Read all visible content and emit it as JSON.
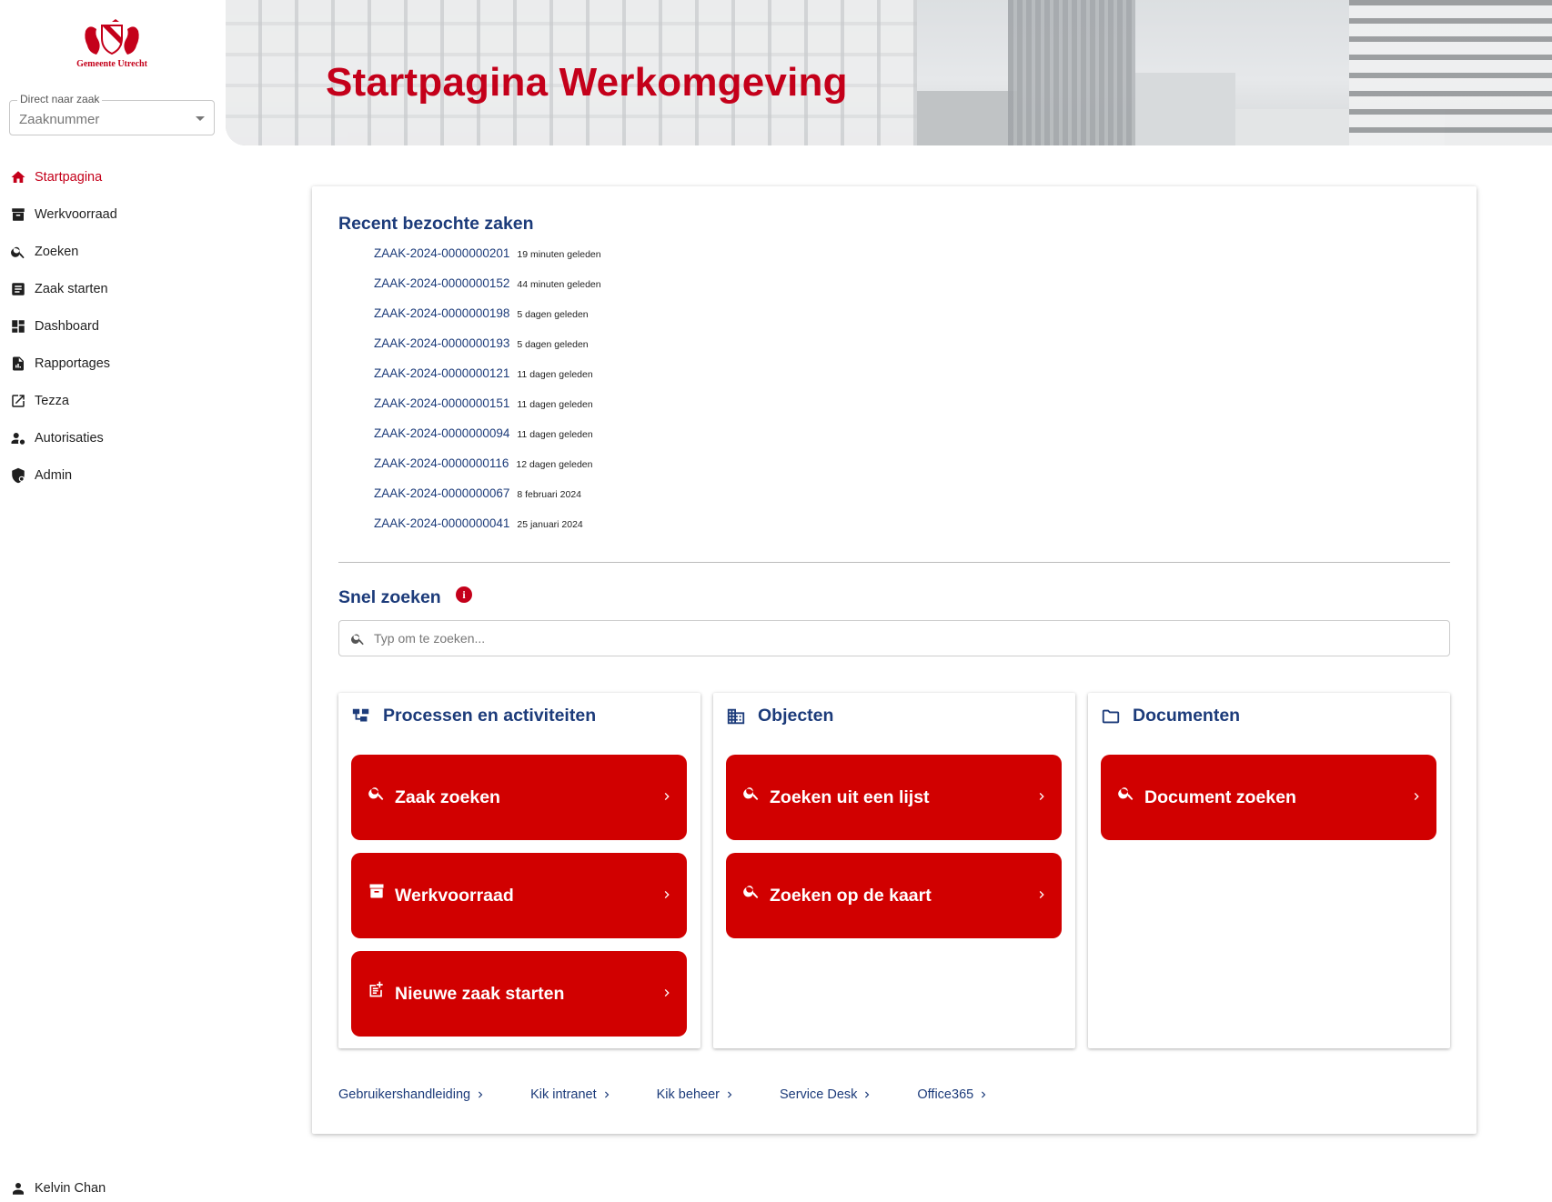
{
  "logo": {
    "text": "Gemeente Utrecht"
  },
  "direct": {
    "label": "Direct naar zaak",
    "placeholder": "Zaaknummer"
  },
  "nav": [
    {
      "label": "Startpagina",
      "icon": "home-icon",
      "active": true
    },
    {
      "label": "Werkvoorraad",
      "icon": "archive-icon"
    },
    {
      "label": "Zoeken",
      "icon": "search-icon"
    },
    {
      "label": "Zaak starten",
      "icon": "document-icon"
    },
    {
      "label": "Dashboard",
      "icon": "dashboard-icon"
    },
    {
      "label": "Rapportages",
      "icon": "report-icon"
    },
    {
      "label": "Tezza",
      "icon": "external-link-icon"
    },
    {
      "label": "Autorisaties",
      "icon": "user-gear-icon"
    },
    {
      "label": "Admin",
      "icon": "admin-shield-icon"
    }
  ],
  "user": {
    "name": "Kelvin Chan"
  },
  "banner": {
    "title": "Startpagina Werkomgeving"
  },
  "recent": {
    "title": "Recent bezochte zaken",
    "items": [
      {
        "id": "ZAAK-2024-0000000201",
        "time": "19 minuten geleden"
      },
      {
        "id": "ZAAK-2024-0000000152",
        "time": "44 minuten geleden"
      },
      {
        "id": "ZAAK-2024-0000000198",
        "time": "5 dagen geleden"
      },
      {
        "id": "ZAAK-2024-0000000193",
        "time": "5 dagen geleden"
      },
      {
        "id": "ZAAK-2024-0000000121",
        "time": "11 dagen geleden"
      },
      {
        "id": "ZAAK-2024-0000000151",
        "time": "11 dagen geleden"
      },
      {
        "id": "ZAAK-2024-0000000094",
        "time": "11 dagen geleden"
      },
      {
        "id": "ZAAK-2024-0000000116",
        "time": "12 dagen geleden"
      },
      {
        "id": "ZAAK-2024-0000000067",
        "time": "8 februari 2024"
      },
      {
        "id": "ZAAK-2024-0000000041",
        "time": "25 januari 2024"
      }
    ]
  },
  "snel": {
    "title": "Snel zoeken",
    "info": "i",
    "placeholder": "Typ om te zoeken..."
  },
  "panels": {
    "processen": {
      "title": "Processen en activiteiten",
      "buttons": [
        "Zaak zoeken",
        "Werkvoorraad",
        "Nieuwe zaak starten"
      ]
    },
    "objecten": {
      "title": "Objecten",
      "buttons": [
        "Zoeken uit een lijst",
        "Zoeken op de kaart"
      ]
    },
    "documenten": {
      "title": "Documenten",
      "buttons": [
        "Document zoeken"
      ]
    }
  },
  "footer_links": [
    "Gebruikershandleiding",
    "Kik intranet",
    "Kik beheer",
    "Service Desk",
    "Office365"
  ],
  "colors": {
    "brand_red": "#c4001a",
    "button_red": "#d10000",
    "link_blue": "#1c3b7a"
  }
}
